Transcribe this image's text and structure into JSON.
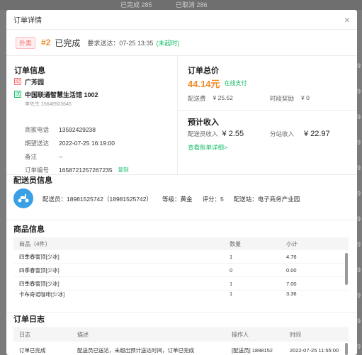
{
  "background": {
    "top_tabs": [
      {
        "label": "已完成",
        "count": "285"
      },
      {
        "label": "已取消",
        "count": "286"
      }
    ],
    "right_edge": [
      "89",
      "89",
      "89",
      "89",
      "89",
      "89",
      "89",
      "89",
      "89",
      "89",
      "89",
      "89"
    ]
  },
  "modal": {
    "title": "订单详情",
    "close": "×"
  },
  "status": {
    "tag": "外卖",
    "order_no": "#2",
    "state": "已完成",
    "required_delivery": "要求送达：07-25 13:35",
    "ontime": "(未超时)"
  },
  "order_info": {
    "title": "订单信息",
    "pickup_badge": "取",
    "pickup_name": "广芳园",
    "send_badge": "送",
    "send_name": "中国联通智慧生活馆 1002",
    "send_contact": "李先生 15648503646",
    "fields": [
      {
        "k": "商家电话",
        "v": "13592429238"
      },
      {
        "k": "期望送达",
        "v": "2022-07-25 16:19:00"
      },
      {
        "k": "备注",
        "v": "--"
      },
      {
        "k": "订单编号",
        "v": "1658721257267235"
      }
    ],
    "copy_label": "复制"
  },
  "order_total": {
    "title": "订单总价",
    "amount": "44.14元",
    "pay_method": "在线支付",
    "delivery_fee_label": "配送费",
    "delivery_fee": "¥ 25.52",
    "time_bonus_label": "时段奖励",
    "time_bonus": "¥ 0"
  },
  "expected_income": {
    "title": "预计收入",
    "rider_label": "配送员收入",
    "rider_value": "¥ 2.55",
    "station_label": "分站收入",
    "station_value": "¥ 22.97",
    "detail_link": "查看账单详细>"
  },
  "rider": {
    "title": "配送员信息",
    "info": "配送员：18981525742（18981525742）",
    "level": "等级：黄金",
    "score": "评分：5",
    "station": "配送站：电子商务产业园"
  },
  "goods": {
    "title": "商品信息",
    "headers": {
      "name": "商品（4件）",
      "qty": "数量",
      "subtotal": "小计"
    },
    "rows": [
      {
        "name": "四季春雪顶[少冰]",
        "qty": "1",
        "subtotal": "4.76"
      },
      {
        "name": "四季春雪顶[少冰]",
        "qty": "0",
        "subtotal": "0.00"
      },
      {
        "name": "四季春雪顶[少冰]",
        "qty": "1",
        "subtotal": "7.00"
      },
      {
        "name": "卡布奇诺咖啡[少冰]",
        "qty": "1",
        "subtotal": "3.36"
      }
    ]
  },
  "log": {
    "title": "订单日志",
    "headers": {
      "log": "日志",
      "desc": "描述",
      "operator": "操作人",
      "time": "时间"
    },
    "rows": [
      {
        "log": "订单已完成",
        "desc": "配送员已送达，未超出预计送达时间，订单已完成",
        "operator": "[配送员] 1898152",
        "time": "2022-07-25 11:55:00"
      }
    ]
  }
}
